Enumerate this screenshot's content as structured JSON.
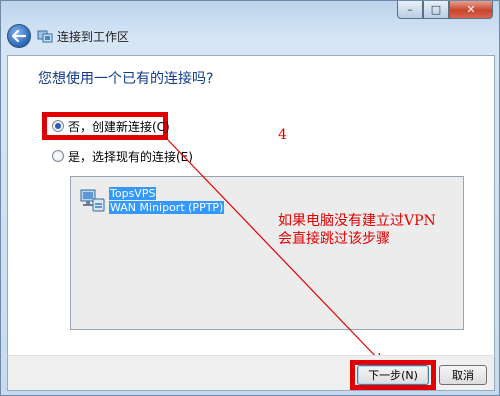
{
  "window": {
    "title": "连接到工作区",
    "caption_minimize": "–",
    "caption_maximize": "□",
    "caption_close": "✕"
  },
  "page": {
    "question": "您想使用一个已有的连接吗?",
    "option_no": "否，创建新连接(C)",
    "option_yes": "是，选择现有的连接(E)",
    "selected_option": "option_no"
  },
  "connections": [
    {
      "name": "TopsVPS",
      "type": "WAN Miniport (PPTP)"
    }
  ],
  "annotations": {
    "step_number": "4",
    "note_line1": "如果电脑没有建立过VPN",
    "note_line2": "会直接跳过该步骤"
  },
  "footer": {
    "next_button": "下一步(N)",
    "cancel_button": "取消"
  },
  "colors": {
    "annotation_red": "#e30000",
    "selection_blue": "#3399ff",
    "heading_blue": "#0f3b8c"
  }
}
